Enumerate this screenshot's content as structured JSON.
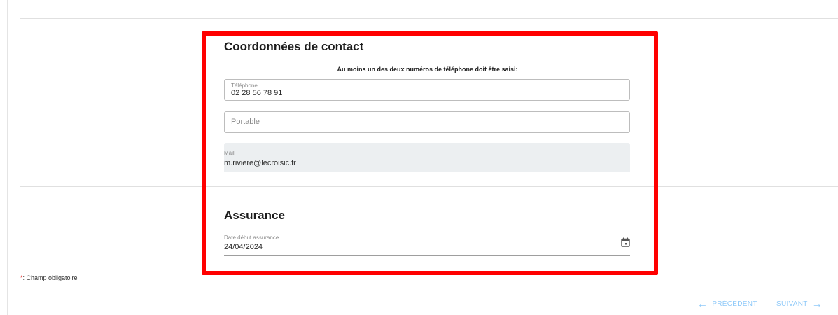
{
  "contact": {
    "title": "Coordonnées de contact",
    "notice": "Au moins un des deux numéros de téléphone doit être saisi:",
    "telephone": {
      "label": "Téléphone",
      "value": "02 28 56 78 91"
    },
    "portable": {
      "placeholder": "Portable"
    },
    "mail": {
      "label": "Mail",
      "value": "m.riviere@lecroisic.fr"
    }
  },
  "assurance": {
    "title": "Assurance",
    "date_debut": {
      "label": "Date début assurance",
      "value": "24/04/2024"
    }
  },
  "footer": {
    "required_star": "*",
    "required_text": ": Champ obligatoire",
    "prev_label": "PRÉCEDENT",
    "next_label": "SUIVANT"
  },
  "colors": {
    "highlight": "#ff0000",
    "nav": "#90caf9",
    "required_star": "#e53935"
  },
  "icons": [
    "calendar-icon",
    "arrow-left-icon",
    "arrow-right-icon"
  ]
}
